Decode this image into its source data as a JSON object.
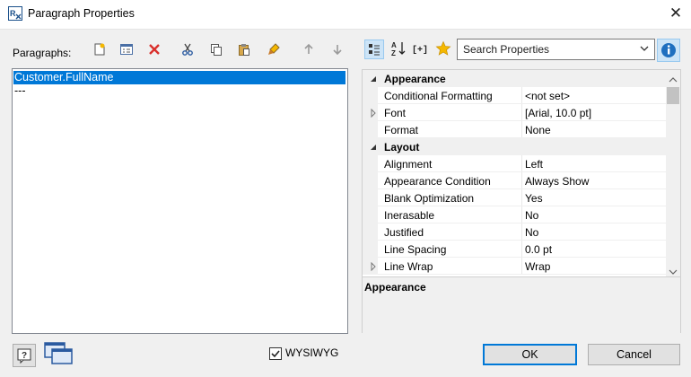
{
  "window": {
    "title": "Paragraph Properties"
  },
  "paragraphs": {
    "label": "Paragraphs:",
    "items": [
      "Customer.FullName",
      "---"
    ]
  },
  "toolbar": {
    "icons": [
      "new-paragraph-icon",
      "properties-icon",
      "delete-icon",
      "cut-icon",
      "copy-icon",
      "paste-icon",
      "format-brush-icon",
      "move-up-icon",
      "move-down-icon"
    ]
  },
  "search": {
    "placeholder": "Search Properties"
  },
  "properties": {
    "rows": [
      {
        "type": "category",
        "name": "Appearance"
      },
      {
        "type": "prop",
        "name": "Conditional Formatting",
        "value": "<not set>"
      },
      {
        "type": "prop",
        "name": "Font",
        "value": "[Arial, 10.0 pt]",
        "expandable": true
      },
      {
        "type": "prop",
        "name": "Format",
        "value": "None"
      },
      {
        "type": "category",
        "name": "Layout"
      },
      {
        "type": "prop",
        "name": "Alignment",
        "value": "Left"
      },
      {
        "type": "prop",
        "name": "Appearance Condition",
        "value": "Always Show"
      },
      {
        "type": "prop",
        "name": "Blank Optimization",
        "value": "Yes"
      },
      {
        "type": "prop",
        "name": "Inerasable",
        "value": "No"
      },
      {
        "type": "prop",
        "name": "Justified",
        "value": "No"
      },
      {
        "type": "prop",
        "name": "Line Spacing",
        "value": "0.0 pt"
      },
      {
        "type": "prop",
        "name": "Line Wrap",
        "value": "Wrap",
        "expandable": true
      }
    ],
    "description_title": "Appearance"
  },
  "footer": {
    "wysiwyg_label": "WYSIWYG",
    "wysiwyg_checked": true,
    "ok_label": "OK",
    "cancel_label": "Cancel"
  },
  "colors": {
    "accent": "#0078d7",
    "selection": "#0078d7"
  }
}
